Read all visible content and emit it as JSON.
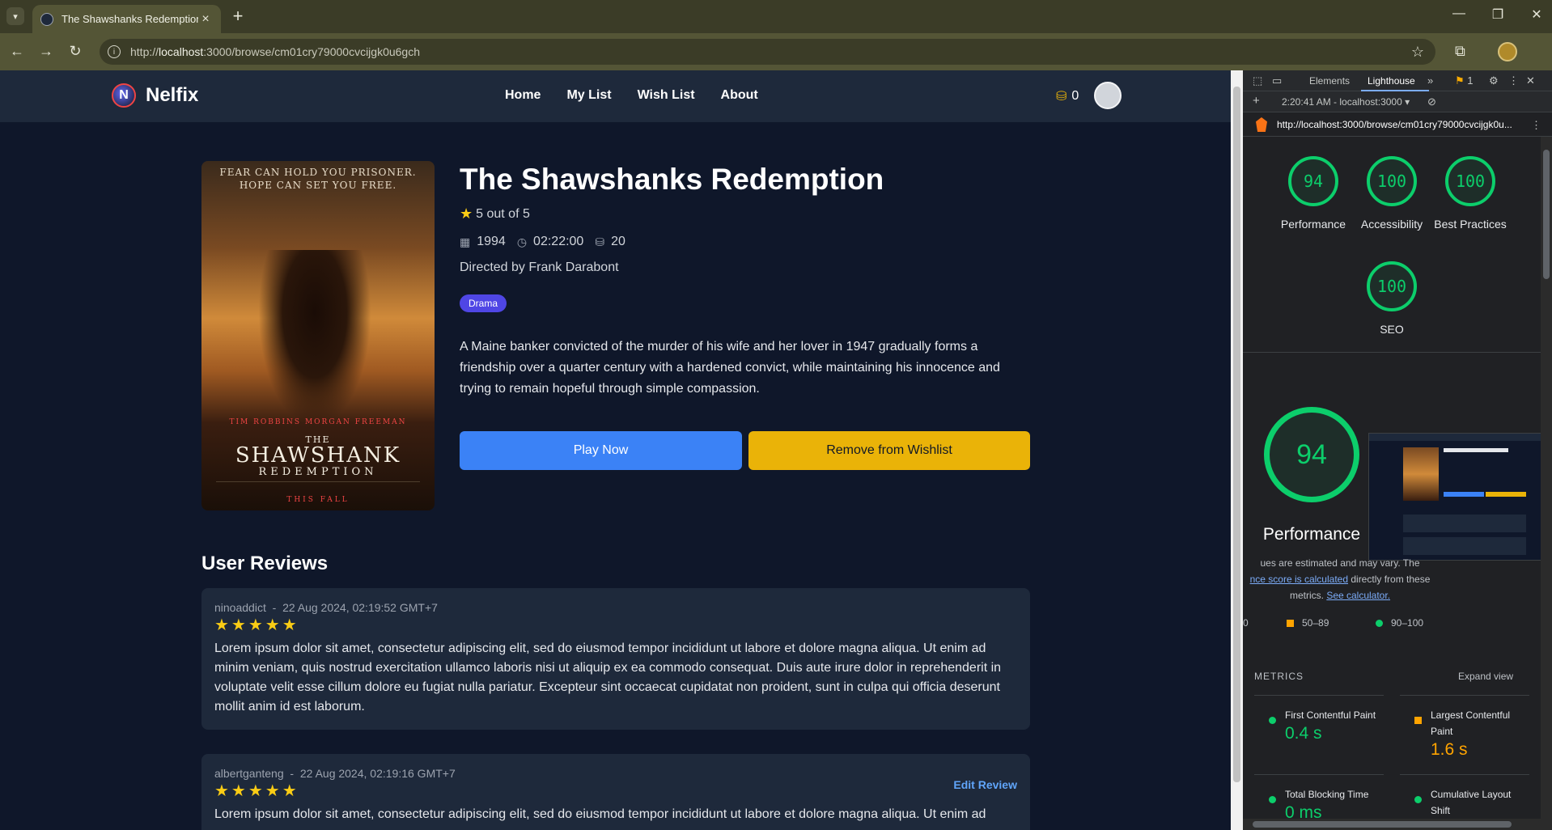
{
  "browser": {
    "tab_title": "The Shawshanks Redemption",
    "url_prefix": "http://",
    "url_host": "localhost",
    "url_rest": ":3000/browse/cm01cry79000cvcijgk0u6gch"
  },
  "site": {
    "brand": "Nelfix",
    "logo_letter": "N",
    "nav": [
      "Home",
      "My List",
      "Wish List",
      "About"
    ],
    "coins": "0"
  },
  "movie": {
    "title": "The Shawshanks Redemption",
    "rating": "5 out of 5",
    "year": "1994",
    "duration": "02:22:00",
    "price": "20",
    "director": "Directed by Frank Darabont",
    "genre": "Drama",
    "synopsis": "A Maine banker convicted of the murder of his wife and her lover in 1947 gradually forms a friendship over a quarter century with a hardened convict, while maintaining his innocence and trying to remain hopeful through simple compassion.",
    "play_label": "Play Now",
    "wishlist_label": "Remove from Wishlist",
    "poster": {
      "tagline": "FEAR CAN HOLD YOU PRISONER. HOPE CAN SET YOU FREE.",
      "cast": "TIM ROBBINS    MORGAN FREEMAN",
      "title_the": "THE",
      "title_main": "SHAWSHANK",
      "title_sub": "REDEMPTION",
      "footer": "THIS FALL"
    }
  },
  "reviews": {
    "heading": "User Reviews",
    "items": [
      {
        "author": "ninoaddict",
        "separator": "-",
        "date": "22 Aug 2024, 02:19:52 GMT+7",
        "stars": "★★★★★",
        "body": "Lorem ipsum dolor sit amet, consectetur adipiscing elit, sed do eiusmod tempor incididunt ut labore et dolore magna aliqua. Ut enim ad minim veniam, quis nostrud exercitation ullamco laboris nisi ut aliquip ex ea commodo consequat. Duis aute irure dolor in reprehenderit in voluptate velit esse cillum dolore eu fugiat nulla pariatur. Excepteur sint occaecat cupidatat non proident, sunt in culpa qui officia deserunt mollit anim id est laborum."
      },
      {
        "author": "albertganteng",
        "separator": "-",
        "date": "22 Aug 2024, 02:19:16 GMT+7",
        "stars": "★★★★★",
        "edit_label": "Edit Review",
        "body": "Lorem ipsum dolor sit amet, consectetur adipiscing elit, sed do eiusmod tempor incididunt ut labore et dolore magna aliqua. Ut enim ad"
      }
    ]
  },
  "devtools": {
    "tabs": [
      "Elements",
      "Lighthouse"
    ],
    "issues_count": "1",
    "report_time": "2:20:41 AM - localhost:3000",
    "report_url": "http://localhost:3000/browse/cm01cry79000cvcijgk0u...",
    "scores": [
      {
        "value": "94",
        "label": "Performance"
      },
      {
        "value": "100",
        "label": "Accessibility"
      },
      {
        "value": "100",
        "label": "Best Practices"
      },
      {
        "value": "100",
        "label": "SEO"
      }
    ],
    "main_score": "94",
    "main_label": "Performance",
    "note_1": "ues are estimated and may vary. The",
    "note_link": "nce score is calculated",
    "note_2": " directly from these",
    "note_3": "metrics.",
    "note_calc": "See calculator.",
    "legend_zero": "0",
    "legend_mid": "50–89",
    "legend_high": "90–100",
    "metrics_heading": "METRICS",
    "expand_label": "Expand view",
    "metrics": [
      {
        "name": "First Contentful Paint",
        "value": "0.4 s",
        "color": "#0cce6b"
      },
      {
        "name": "Largest Contentful Paint",
        "value": "1.6 s",
        "color": "#ffa400"
      },
      {
        "name": "Total Blocking Time",
        "value": "0 ms",
        "color": "#0cce6b"
      },
      {
        "name": "Cumulative Layout Shift",
        "value": "",
        "color": "#0cce6b"
      }
    ]
  },
  "colors": {
    "accent_blue": "#3b82f6",
    "accent_yellow": "#eab308",
    "genre_badge": "#4f46e5",
    "lighthouse_green": "#0cce6b",
    "lighthouse_orange": "#ffa400"
  }
}
